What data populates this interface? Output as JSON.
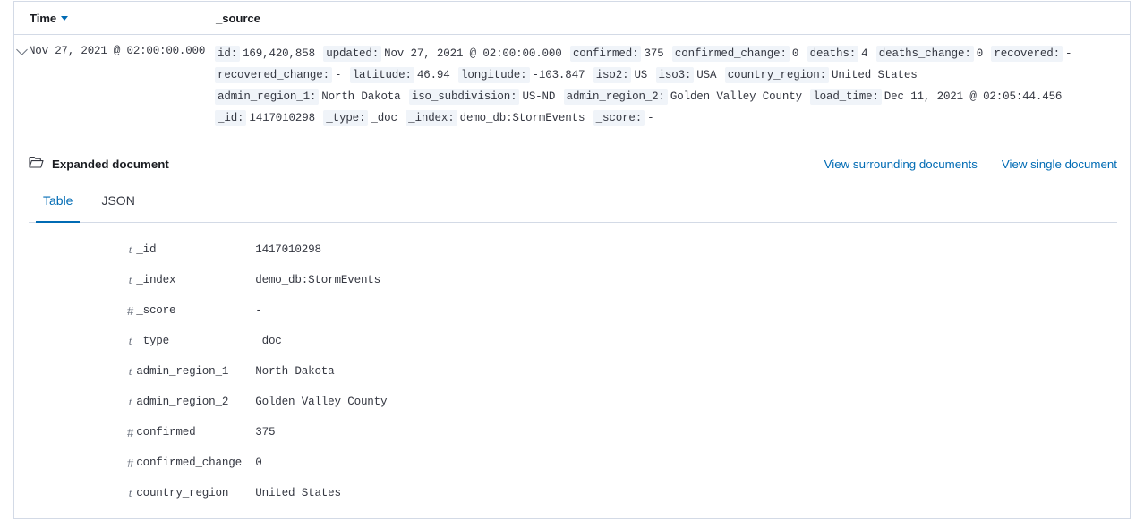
{
  "table": {
    "columns": [
      {
        "label": "Time",
        "sorted": true,
        "sort_direction": "desc"
      },
      {
        "label": "_source",
        "sorted": false
      }
    ]
  },
  "row": {
    "expand_icon": "chevron-down-icon",
    "time": "Nov 27, 2021 @ 02:00:00.000",
    "source_pairs": [
      {
        "key": "id:",
        "value": "169,420,858"
      },
      {
        "key": "updated:",
        "value": "Nov 27, 2021 @ 02:00:00.000"
      },
      {
        "key": "confirmed:",
        "value": "375"
      },
      {
        "key": "confirmed_change:",
        "value": "0"
      },
      {
        "key": "deaths:",
        "value": "4"
      },
      {
        "key": "deaths_change:",
        "value": "0"
      },
      {
        "key": "recovered:",
        "value": "-"
      },
      {
        "key": "recovered_change:",
        "value": "-"
      },
      {
        "key": "latitude:",
        "value": "46.94"
      },
      {
        "key": "longitude:",
        "value": "-103.847"
      },
      {
        "key": "iso2:",
        "value": "US"
      },
      {
        "key": "iso3:",
        "value": "USA"
      },
      {
        "key": "country_region:",
        "value": "United States"
      },
      {
        "key": "admin_region_1:",
        "value": "North Dakota"
      },
      {
        "key": "iso_subdivision:",
        "value": "US-ND"
      },
      {
        "key": "admin_region_2:",
        "value": "Golden Valley County"
      },
      {
        "key": "load_time:",
        "value": "Dec 11, 2021 @ 02:05:44.456"
      },
      {
        "key": "_id:",
        "value": "1417010298"
      },
      {
        "key": "_type:",
        "value": "_doc"
      },
      {
        "key": "_index:",
        "value": "demo_db:StormEvents"
      },
      {
        "key": "_score:",
        "value": "-"
      }
    ]
  },
  "expanded": {
    "icon": "folder-open-icon",
    "title": "Expanded document",
    "links": [
      {
        "label": "View surrounding documents"
      },
      {
        "label": "View single document"
      }
    ],
    "tabs": [
      {
        "label": "Table",
        "active": true
      },
      {
        "label": "JSON",
        "active": false
      }
    ],
    "fields": [
      {
        "type": "t",
        "name": "_id",
        "value": "1417010298"
      },
      {
        "type": "t",
        "name": "_index",
        "value": "demo_db:StormEvents"
      },
      {
        "type": "#",
        "name": "_score",
        "value": "-"
      },
      {
        "type": "t",
        "name": "_type",
        "value": "_doc"
      },
      {
        "type": "t",
        "name": "admin_region_1",
        "value": "North Dakota"
      },
      {
        "type": "t",
        "name": "admin_region_2",
        "value": "Golden Valley County"
      },
      {
        "type": "#",
        "name": "confirmed",
        "value": "375"
      },
      {
        "type": "#",
        "name": "confirmed_change",
        "value": "0"
      },
      {
        "type": "t",
        "name": "country_region",
        "value": "United States"
      }
    ]
  },
  "colors": {
    "link": "#006bb4",
    "text": "#343741",
    "border": "#d3dae6",
    "key_background": "#f0f4f9"
  }
}
